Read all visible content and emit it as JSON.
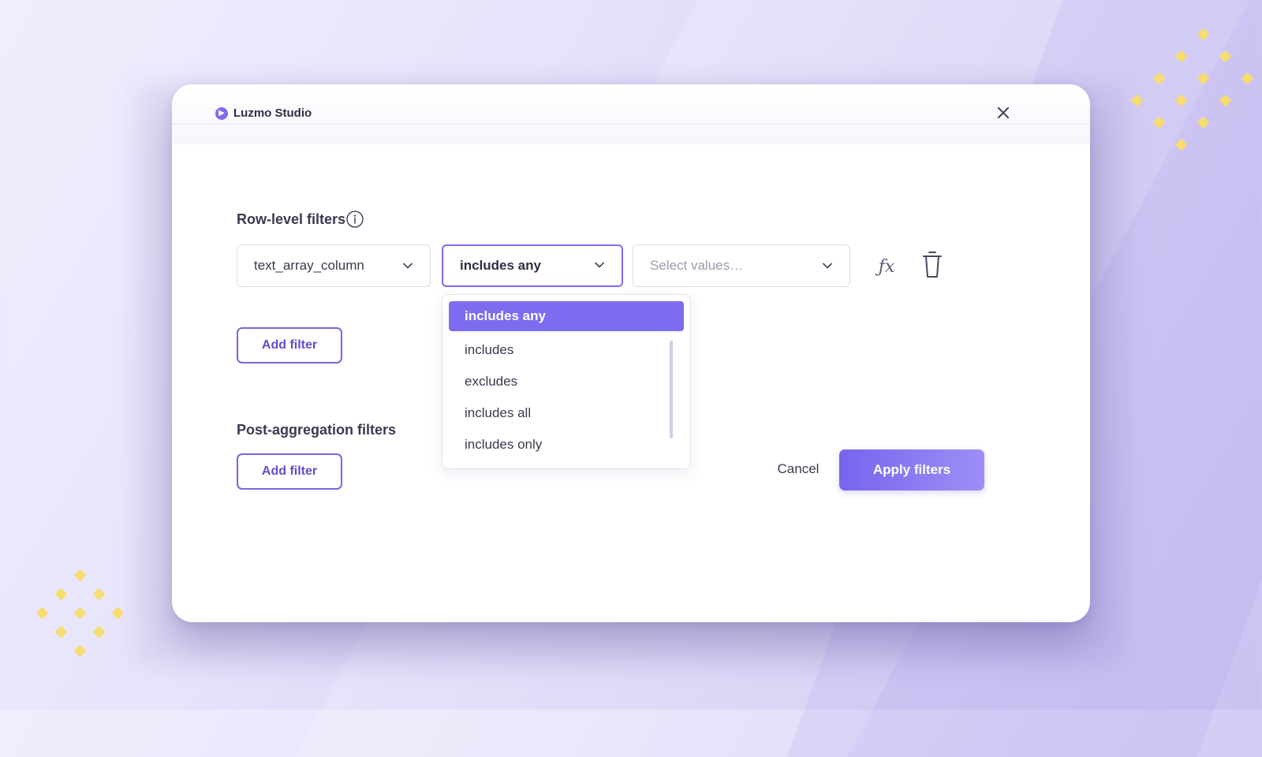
{
  "app": {
    "brand_name": "Luzmo Studio",
    "accent_color": "#7c6cf0",
    "decoration_color": "#f7dc6e"
  },
  "row_level": {
    "title": "Row-level filters",
    "info_icon": "info-icon",
    "column_select": {
      "value": "text_array_column"
    },
    "operator_select": {
      "value": "includes any"
    },
    "values_select": {
      "placeholder": "Select values…"
    },
    "formula_icon": "function-icon",
    "formula_label": "ƒx",
    "delete_icon": "trash-icon",
    "add_filter_label": "Add filter"
  },
  "operator_dropdown": {
    "options": [
      {
        "label": "includes any",
        "selected": true
      },
      {
        "label": "includes",
        "selected": false
      },
      {
        "label": "excludes",
        "selected": false
      },
      {
        "label": "includes all",
        "selected": false
      },
      {
        "label": "includes only",
        "selected": false
      }
    ]
  },
  "post_aggregation": {
    "title": "Post-aggregation filters",
    "add_filter_label": "Add filter"
  },
  "footer": {
    "cancel_label": "Cancel",
    "apply_label": "Apply filters"
  }
}
